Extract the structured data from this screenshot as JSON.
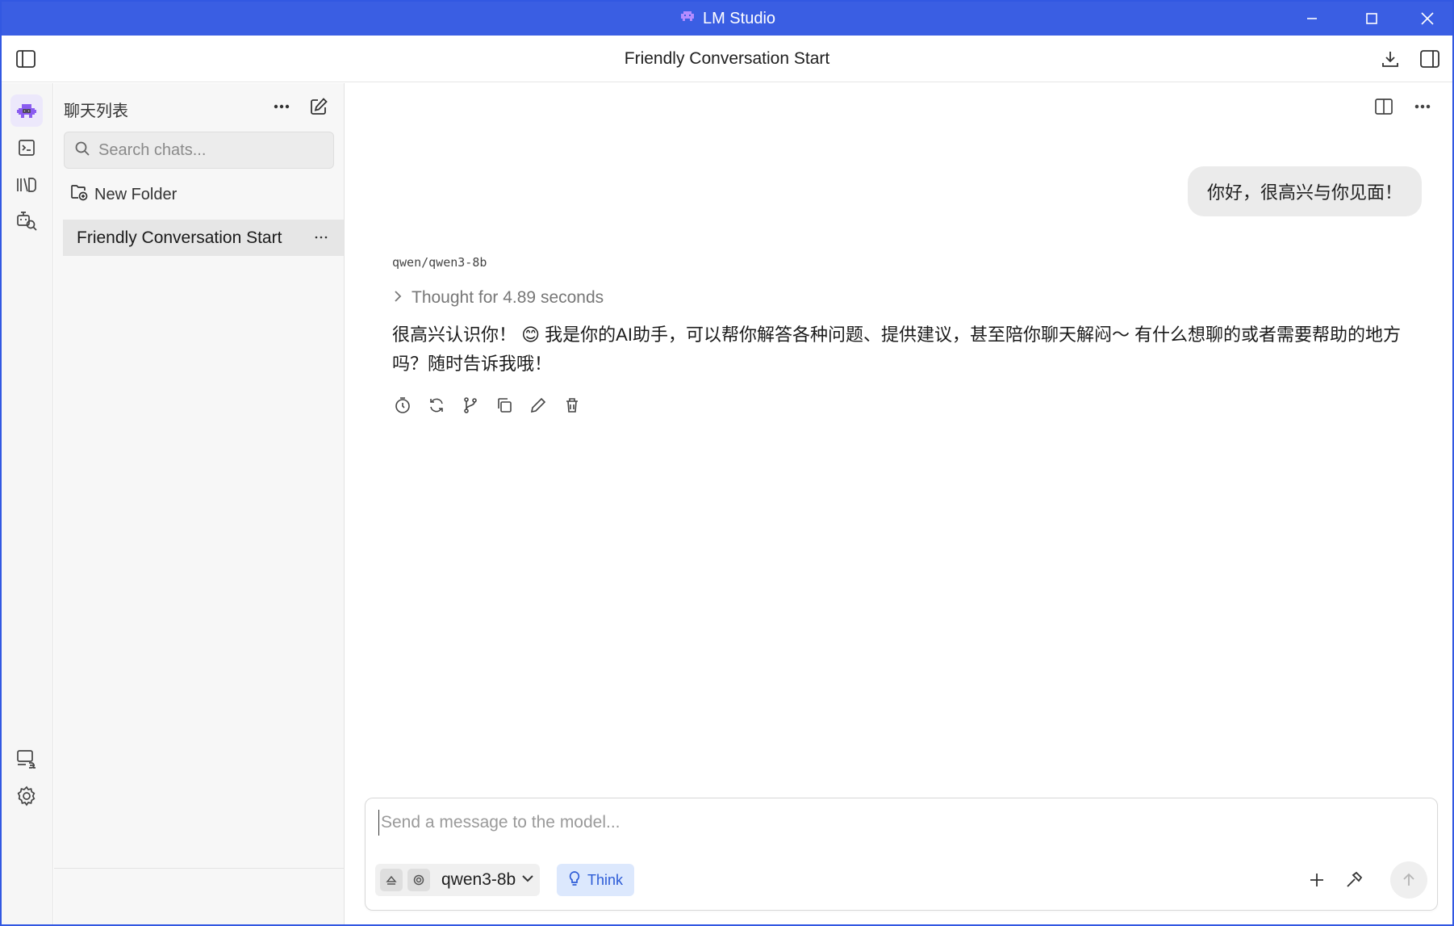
{
  "window": {
    "title": "LM Studio",
    "accent": "#3a5ee3"
  },
  "header": {
    "title": "Friendly Conversation Start"
  },
  "sidebar": {
    "title": "聊天列表",
    "search_placeholder": "Search chats...",
    "new_folder_label": "New Folder",
    "chats": [
      {
        "label": "Friendly Conversation Start",
        "selected": true
      }
    ]
  },
  "conversation": {
    "user_message": "你好，很高兴与你见面！",
    "model_id": "qwen/qwen3-8b",
    "thought_label": "Thought for 4.89 seconds",
    "reply": "很高兴认识你！ 😊 我是你的AI助手，可以帮你解答各种问题、提供建议，甚至陪你聊天解闷～ 有什么想聊的或者需要帮助的地方吗？随时告诉我哦！"
  },
  "composer": {
    "placeholder": "Send a message to the model...",
    "model_label": "qwen3-8b",
    "think_label": "Think"
  },
  "icons": {
    "app": "alien-icon",
    "rail": [
      "chat-icon",
      "terminal-icon",
      "library-icon",
      "model-search-icon",
      "remote-link-icon",
      "settings-icon"
    ]
  }
}
